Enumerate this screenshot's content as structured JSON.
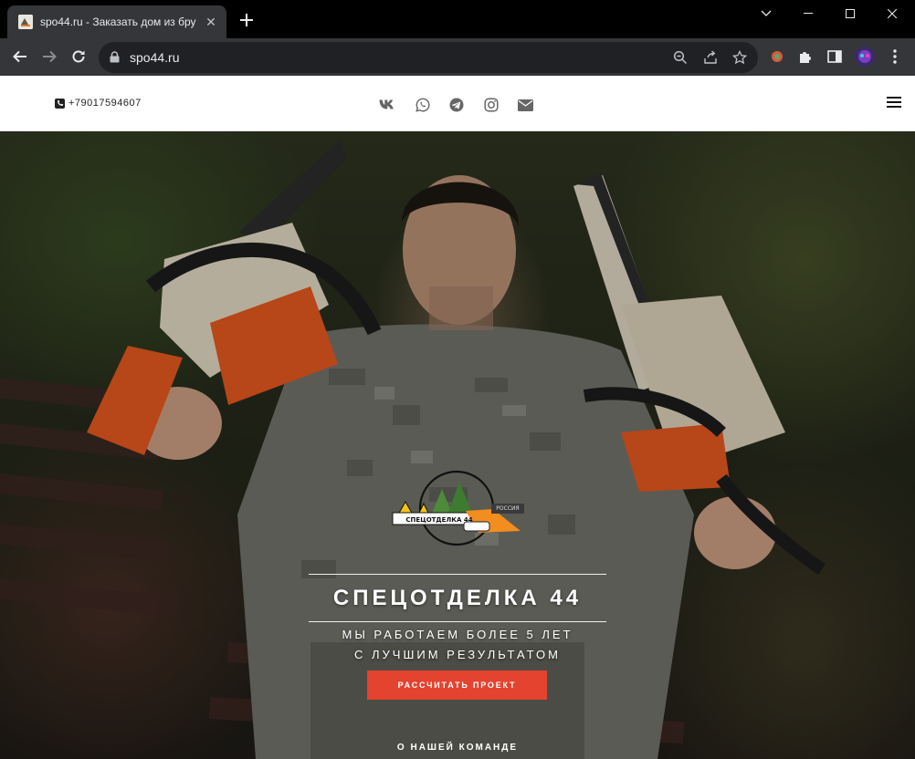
{
  "browser": {
    "tab_title": "spo44.ru - Заказать дом из бру",
    "url": "spo44.ru"
  },
  "icons": {
    "tab_close": "close-icon",
    "new_tab": "plus-icon",
    "back": "arrow-left-icon",
    "forward": "arrow-right-icon",
    "reload": "reload-icon",
    "lock": "lock-icon",
    "zoom": "zoom-icon",
    "share": "share-icon",
    "bookmark": "star-icon",
    "menu": "kebab-icon"
  },
  "header": {
    "phone": "+79017594607",
    "socials": [
      "vk-icon",
      "whatsapp-icon",
      "telegram-icon",
      "instagram-icon",
      "email-icon"
    ]
  },
  "hero": {
    "logo_text": "СПЕЦОТДЕЛКА 44",
    "logo_badge": "РОССИЯ",
    "title": "СПЕЦОТДЕЛКА 44",
    "subtitle_line1": "МЫ РАБОТАЕМ БОЛЕЕ 5 ЛЕТ",
    "subtitle_line2": "С ЛУЧШИМ РЕЗУЛЬТАТОМ",
    "cta_label": "РАССЧИТАТЬ ПРОЕКТ",
    "team_link": "О НАШЕЙ КОМАНДЕ"
  },
  "colors": {
    "cta": "#e4432f",
    "chrome_dark": "#202124",
    "chrome_toolbar": "#35363a"
  }
}
